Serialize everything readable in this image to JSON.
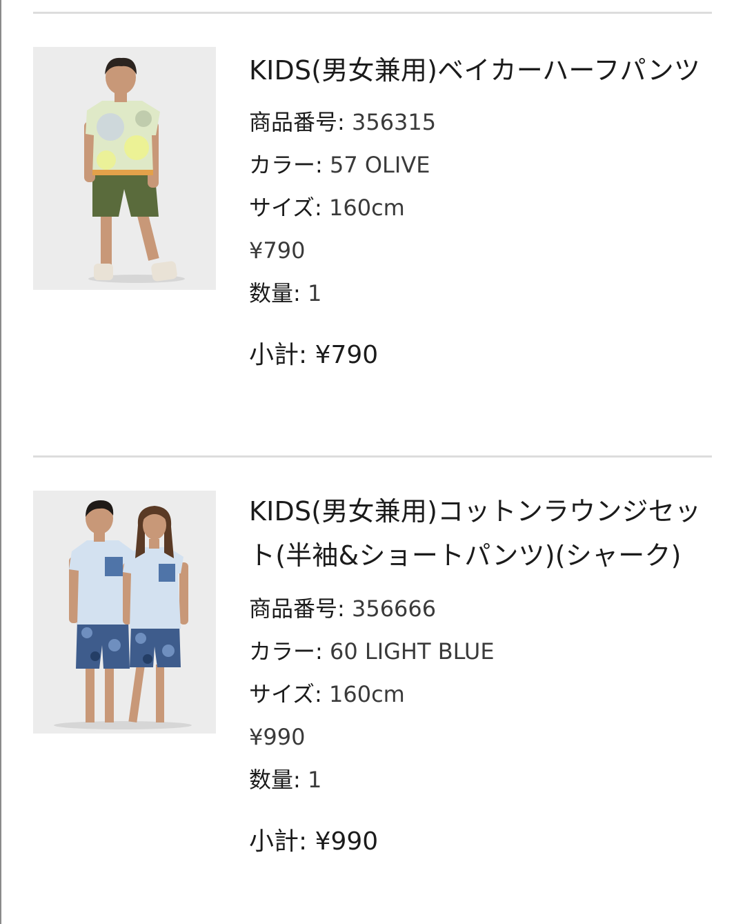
{
  "items": [
    {
      "name": "KIDS(男女兼用)ベイカーハーフパンツ",
      "product_number_label": "商品番号",
      "product_number": "356315",
      "color_label": "カラー",
      "color": "57 OLIVE",
      "size_label": "サイズ",
      "size": "160cm",
      "price": "¥790",
      "quantity_label": "数量",
      "quantity": "1",
      "subtotal_label": "小計",
      "subtotal": "¥790"
    },
    {
      "name": "KIDS(男女兼用)コットンラウンジセット(半袖&ショートパンツ)(シャーク)",
      "product_number_label": "商品番号",
      "product_number": "356666",
      "color_label": "カラー",
      "color": "60 LIGHT BLUE",
      "size_label": "サイズ",
      "size": "160cm",
      "price": "¥990",
      "quantity_label": "数量",
      "quantity": "1",
      "subtotal_label": "小計",
      "subtotal": "¥990"
    }
  ],
  "colors": {
    "text": "#1b1b1b",
    "divider": "#dcdcdc",
    "image_bg": "#ebebeb"
  }
}
